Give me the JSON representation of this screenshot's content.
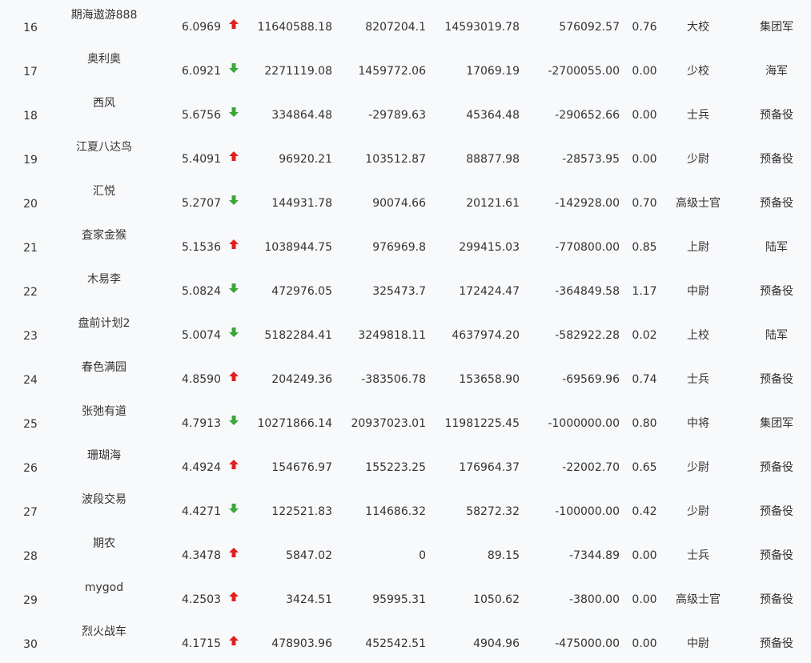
{
  "colors": {
    "up": "#e02020",
    "down": "#3aa83a",
    "text": "#333333",
    "background": "#f8f9fb"
  },
  "rows": [
    {
      "rank": "16",
      "name": "期海遨游888",
      "score": "6.0969",
      "trend": "up",
      "v1": "11640588.18",
      "v2": "8207204.1",
      "v3": "14593019.78",
      "v4": "576092.57",
      "ratio": "0.76",
      "title": "大校",
      "rank2": "集团军"
    },
    {
      "rank": "17",
      "name": "奥利奥",
      "score": "6.0921",
      "trend": "down",
      "v1": "2271119.08",
      "v2": "1459772.06",
      "v3": "17069.19",
      "v4": "-2700055.00",
      "ratio": "0.00",
      "title": "少校",
      "rank2": "海军"
    },
    {
      "rank": "18",
      "name": "西风",
      "score": "5.6756",
      "trend": "down",
      "v1": "334864.48",
      "v2": "-29789.63",
      "v3": "45364.48",
      "v4": "-290652.66",
      "ratio": "0.00",
      "title": "士兵",
      "rank2": "预备役"
    },
    {
      "rank": "19",
      "name": "江夏八达鸟",
      "score": "5.4091",
      "trend": "up",
      "v1": "96920.21",
      "v2": "103512.87",
      "v3": "88877.98",
      "v4": "-28573.95",
      "ratio": "0.00",
      "title": "少尉",
      "rank2": "预备役"
    },
    {
      "rank": "20",
      "name": "汇悦",
      "score": "5.2707",
      "trend": "down",
      "v1": "144931.78",
      "v2": "90074.66",
      "v3": "20121.61",
      "v4": "-142928.00",
      "ratio": "0.70",
      "title": "高级士官",
      "rank2": "预备役"
    },
    {
      "rank": "21",
      "name": "査家金猴",
      "score": "5.1536",
      "trend": "up",
      "v1": "1038944.75",
      "v2": "976969.8",
      "v3": "299415.03",
      "v4": "-770800.00",
      "ratio": "0.85",
      "title": "上尉",
      "rank2": "陆军"
    },
    {
      "rank": "22",
      "name": "木易李",
      "score": "5.0824",
      "trend": "down",
      "v1": "472976.05",
      "v2": "325473.7",
      "v3": "172424.47",
      "v4": "-364849.58",
      "ratio": "1.17",
      "title": "中尉",
      "rank2": "预备役"
    },
    {
      "rank": "23",
      "name": "盘前计划2",
      "score": "5.0074",
      "trend": "down",
      "v1": "5182284.41",
      "v2": "3249818.11",
      "v3": "4637974.20",
      "v4": "-582922.28",
      "ratio": "0.02",
      "title": "上校",
      "rank2": "陆军"
    },
    {
      "rank": "24",
      "name": "春色满园",
      "score": "4.8590",
      "trend": "up",
      "v1": "204249.36",
      "v2": "-383506.78",
      "v3": "153658.90",
      "v4": "-69569.96",
      "ratio": "0.74",
      "title": "士兵",
      "rank2": "预备役"
    },
    {
      "rank": "25",
      "name": "张弛有道",
      "score": "4.7913",
      "trend": "down",
      "v1": "10271866.14",
      "v2": "20937023.01",
      "v3": "11981225.45",
      "v4": "-1000000.00",
      "ratio": "0.80",
      "title": "中将",
      "rank2": "集团军"
    },
    {
      "rank": "26",
      "name": "珊瑚海",
      "score": "4.4924",
      "trend": "up",
      "v1": "154676.97",
      "v2": "155223.25",
      "v3": "176964.37",
      "v4": "-22002.70",
      "ratio": "0.65",
      "title": "少尉",
      "rank2": "预备役"
    },
    {
      "rank": "27",
      "name": "波段交易",
      "score": "4.4271",
      "trend": "down",
      "v1": "122521.83",
      "v2": "114686.32",
      "v3": "58272.32",
      "v4": "-100000.00",
      "ratio": "0.42",
      "title": "少尉",
      "rank2": "预备役"
    },
    {
      "rank": "28",
      "name": "期农",
      "score": "4.3478",
      "trend": "up",
      "v1": "5847.02",
      "v2": "0",
      "v3": "89.15",
      "v4": "-7344.89",
      "ratio": "0.00",
      "title": "士兵",
      "rank2": "预备役"
    },
    {
      "rank": "29",
      "name": "mygod",
      "score": "4.2503",
      "trend": "up",
      "v1": "3424.51",
      "v2": "95995.31",
      "v3": "1050.62",
      "v4": "-3800.00",
      "ratio": "0.00",
      "title": "高级士官",
      "rank2": "预备役"
    },
    {
      "rank": "30",
      "name": "烈火战车",
      "score": "4.1715",
      "trend": "up",
      "v1": "478903.96",
      "v2": "452542.51",
      "v3": "4904.96",
      "v4": "-475000.00",
      "ratio": "0.00",
      "title": "中尉",
      "rank2": "预备役"
    }
  ]
}
